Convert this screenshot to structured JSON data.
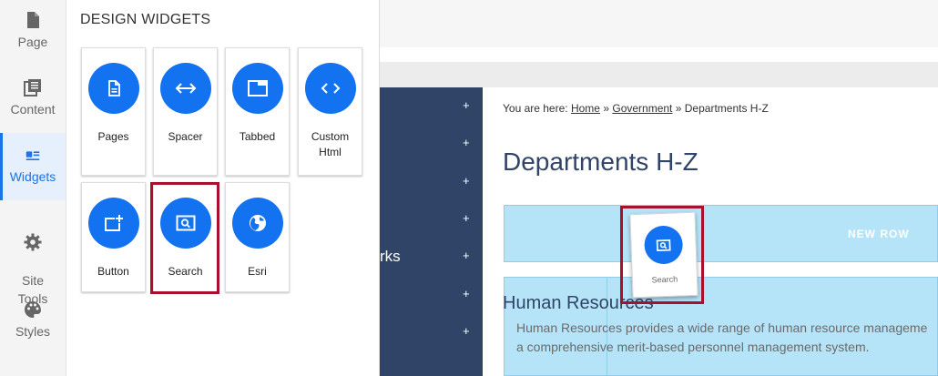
{
  "rail": {
    "items": [
      {
        "label": "Page",
        "icon": "page-icon"
      },
      {
        "label": "Content",
        "icon": "content-icon"
      },
      {
        "label": "Widgets",
        "icon": "widgets-icon"
      },
      {
        "label": "Site\nTools",
        "icon": "gear-icon"
      },
      {
        "label": "Styles",
        "icon": "palette-icon"
      }
    ]
  },
  "panel": {
    "title": "DESIGN WIDGETS",
    "widgets": [
      {
        "label": "Pages",
        "icon": "document-icon"
      },
      {
        "label": "Spacer",
        "icon": "horizontal-arrows-icon"
      },
      {
        "label": "Tabbed",
        "icon": "tab-icon"
      },
      {
        "label": "Custom Html",
        "icon": "code-icon"
      },
      {
        "label": "Button",
        "icon": "add-button-icon"
      },
      {
        "label": "Search",
        "icon": "search-icon"
      },
      {
        "label": "Esri",
        "icon": "globe-icon"
      }
    ]
  },
  "preview": {
    "breadcrumb": {
      "prefix": "You are here:",
      "home": "Home",
      "sep1": "»",
      "government": " Government",
      "sep2": "»",
      "current": "Departments H-Z"
    },
    "page_title": "Departments H-Z",
    "new_row": "NEW ROW",
    "nav_text": "rks",
    "nav_plus": "+",
    "hr_title": "Human Resources",
    "hr_line1": "Human Resources provides a wide range of human resource manageme",
    "hr_line2": "a comprehensive merit-based personnel management system."
  },
  "ghost": {
    "label": "Search",
    "icon": "search-icon"
  },
  "colors": {
    "accent": "#1372f0",
    "highlight": "#a8102e",
    "navy": "#2f4466",
    "row": "#b5e3f8"
  }
}
